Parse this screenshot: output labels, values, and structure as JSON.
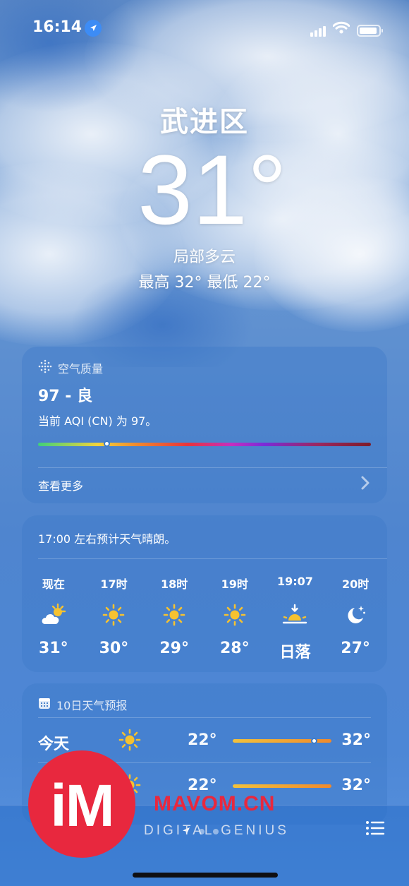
{
  "status_bar": {
    "time": "16:14"
  },
  "hero": {
    "city": "武进区",
    "temperature": "31°",
    "condition": "局部多云",
    "high_low": "最高 32°  最低 22°"
  },
  "air_quality": {
    "title": "空气质量",
    "value": "97 - 良",
    "description": "当前 AQI (CN) 为 97。",
    "level": 0.198,
    "see_more": "查看更多",
    "icon": "air-quality-icon"
  },
  "hourly": {
    "summary": "17:00 左右预计天气晴朗。",
    "items": [
      {
        "label": "现在",
        "icon": "partly-sunny-icon",
        "temp": "31°"
      },
      {
        "label": "17时",
        "icon": "sun-icon",
        "temp": "30°"
      },
      {
        "label": "18时",
        "icon": "sun-icon",
        "temp": "29°"
      },
      {
        "label": "19时",
        "icon": "sun-icon",
        "temp": "28°"
      },
      {
        "label": "19:07",
        "icon": "sunset-icon",
        "temp": "日落"
      },
      {
        "label": "20时",
        "icon": "moon-stars-icon",
        "temp": "27°"
      }
    ]
  },
  "daily": {
    "title": "10日天气预报",
    "icon": "calendar-icon",
    "days": [
      {
        "name": "今天",
        "icon": "sun-icon",
        "low": "22°",
        "high": "32°",
        "bar_start": 0.0,
        "bar_end": 1.0,
        "current": 0.82
      },
      {
        "name": "",
        "icon": "sun-icon",
        "low": "22°",
        "high": "32°",
        "bar_start": 0.0,
        "bar_end": 1.0
      }
    ]
  },
  "watermark": {
    "logo": "iM",
    "brand": "MAVOM.CN",
    "tagline": "DIGITAL GENIUS"
  },
  "colors": {
    "sun": "#f6c230",
    "aqi_marker": "#ffffff",
    "logo_red": "#e8283e"
  }
}
